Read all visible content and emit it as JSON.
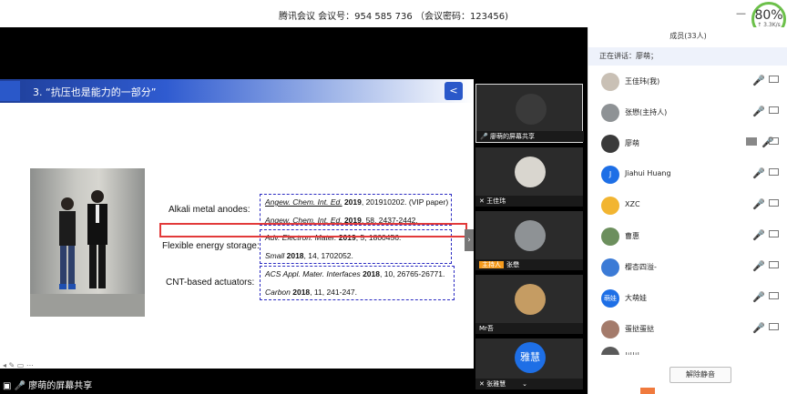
{
  "window": {
    "title": "腾讯会议 会议号：954 585 736 （会议密码：123456)",
    "minimize": "—",
    "network": {
      "percent": "80%",
      "speed": "↑ 3.3K/s"
    }
  },
  "slide": {
    "heading": "3. “抗压也是能力的一部分”",
    "labels": [
      "Alkali metal anodes:",
      "Flexible energy storage:",
      "CNT-based actuators:"
    ],
    "refs": [
      {
        "j": "Angew. Chem. Int. Ed.",
        "y": " 2019",
        "rest": ", 201910202. (VIP paper)"
      },
      {
        "j": "Angew. Chem. Int. Ed.",
        "y": " 2019",
        "rest": ", 58, 2437-2442."
      },
      {
        "j": "Adv. Electron. Mater.",
        "y": " 2019",
        "rest": ", 5, 1800456."
      },
      {
        "j": "Small",
        "y": " 2018",
        "rest": ", 14, 1702052."
      },
      {
        "j": "ACS Appl. Mater. Interfaces",
        "y": " 2018",
        "rest": ", 10, 26765-26771."
      },
      {
        "j": "Carbon",
        "y": " 2018",
        "rest": ", 11, 241-247."
      }
    ],
    "tools": "◂ ✎ ▭ ⋯"
  },
  "share_label": "廖萌的屏幕共享",
  "video_tiles": [
    {
      "name": "廖萌的屏幕共享",
      "color": "#3a3a3a",
      "host": ""
    },
    {
      "name": "王佳玮",
      "color": "#d9d6cf",
      "host": ""
    },
    {
      "name": "张懋",
      "color": "#8e9295",
      "host": "主持人"
    },
    {
      "name": "Mr吾",
      "color": "#c59c63",
      "host": ""
    },
    {
      "name": "张雅慧",
      "color": "#1e6fe6",
      "host": "",
      "initials": "雅慧"
    }
  ],
  "panel": {
    "title": "成员(33人)",
    "speaking": "正在讲话：廖萌；",
    "unmute_all": "解除静音",
    "members": [
      {
        "name": "王佳玮(我)",
        "color": "#c9c0b5",
        "initials": "",
        "mic": "muted"
      },
      {
        "name": "张懋(主持人)",
        "color": "#8e9295",
        "initials": "",
        "mic": "muted"
      },
      {
        "name": "廖萌",
        "color": "#3a3a3a",
        "initials": "",
        "mic": "on"
      },
      {
        "name": "Jiahui Huang",
        "color": "#1e6fe6",
        "initials": "J",
        "mic": "muted"
      },
      {
        "name": "XZC",
        "color": "#f2b531",
        "initials": "",
        "mic": "muted"
      },
      {
        "name": "曹惠",
        "color": "#6c8f5d",
        "initials": "",
        "mic": "muted"
      },
      {
        "name": "樱杏四溢-",
        "color": "#3c7bd6",
        "initials": "",
        "mic": "muted"
      },
      {
        "name": "大萌娃",
        "color": "#1e6fe6",
        "initials": "萌娃",
        "mic": "muted"
      },
      {
        "name": "蛋挞蛋挞",
        "color": "#a47b6b",
        "initials": "",
        "mic": "muted"
      },
      {
        "name": "川川",
        "color": "#5a5a5a",
        "initials": "",
        "mic": "muted"
      }
    ]
  }
}
